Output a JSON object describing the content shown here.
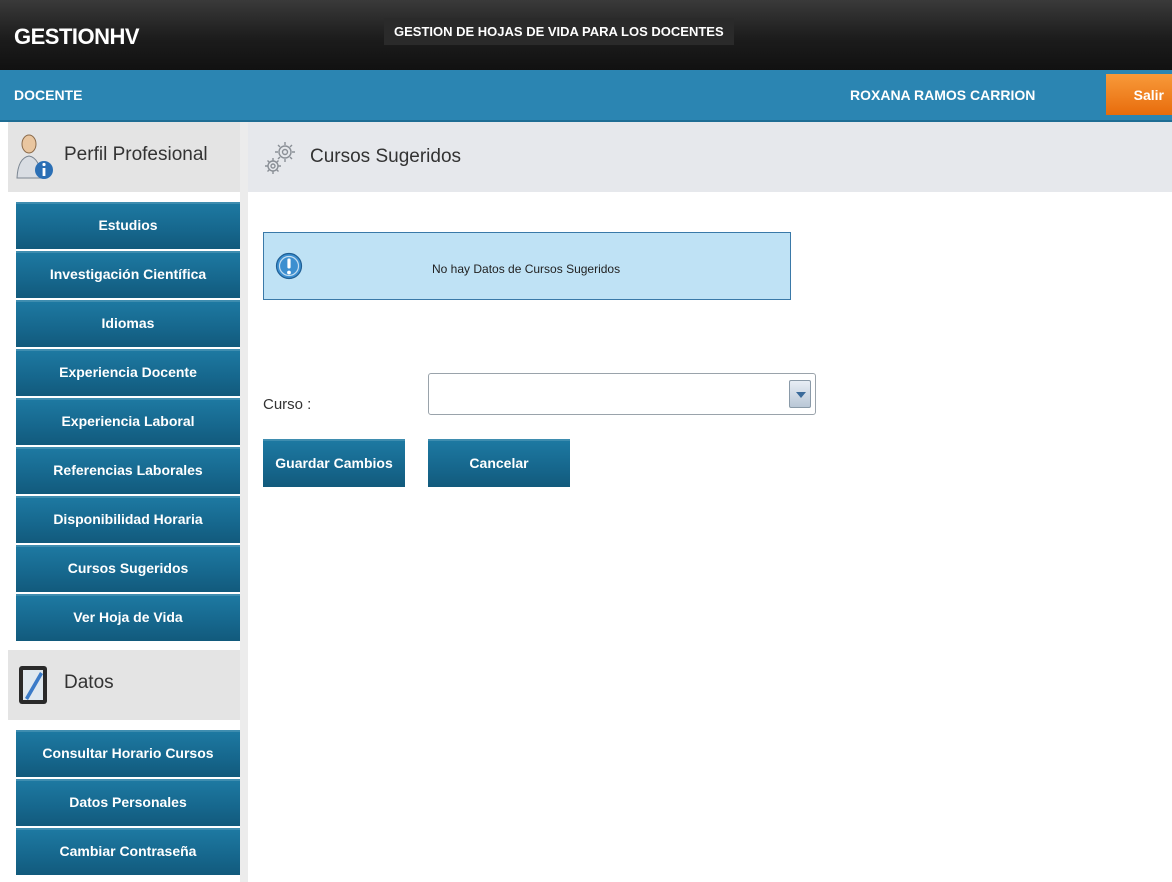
{
  "header": {
    "app_title": "GESTIONHV",
    "subtitle": "GESTION DE HOJAS DE VIDA PARA LOS DOCENTES"
  },
  "rolebar": {
    "role": "DOCENTE",
    "user": "ROXANA RAMOS CARRION",
    "logout_label": "Salir"
  },
  "sidebar": {
    "section1": {
      "label": "Perfil Profesional",
      "icon": "user-info-icon",
      "items": [
        {
          "label": "Estudios"
        },
        {
          "label": "Investigación Científica"
        },
        {
          "label": "Idiomas"
        },
        {
          "label": "Experiencia Docente"
        },
        {
          "label": "Experiencia Laboral"
        },
        {
          "label": "Referencias Laborales"
        },
        {
          "label": "Disponibilidad Horaria"
        },
        {
          "label": "Cursos Sugeridos"
        },
        {
          "label": "Ver Hoja de Vida"
        }
      ]
    },
    "section2": {
      "label": "Datos",
      "icon": "tablet-pen-icon",
      "items": [
        {
          "label": "Consultar Horario Cursos"
        },
        {
          "label": "Datos Personales"
        },
        {
          "label": "Cambiar Contraseña"
        }
      ]
    }
  },
  "main": {
    "title": "Cursos Sugeridos",
    "title_icon": "gears-icon",
    "info_message": "No hay Datos de Cursos Sugeridos",
    "form": {
      "curso_label": "Curso :",
      "curso_value": "",
      "save_label": "Guardar Cambios",
      "cancel_label": "Cancelar"
    }
  },
  "colors": {
    "topbar": "#1c1c1c",
    "rolebar": "#2b85b2",
    "menu_button": "#16678d",
    "logout": "#e86c0c",
    "info_bg": "#bfe2f5"
  }
}
